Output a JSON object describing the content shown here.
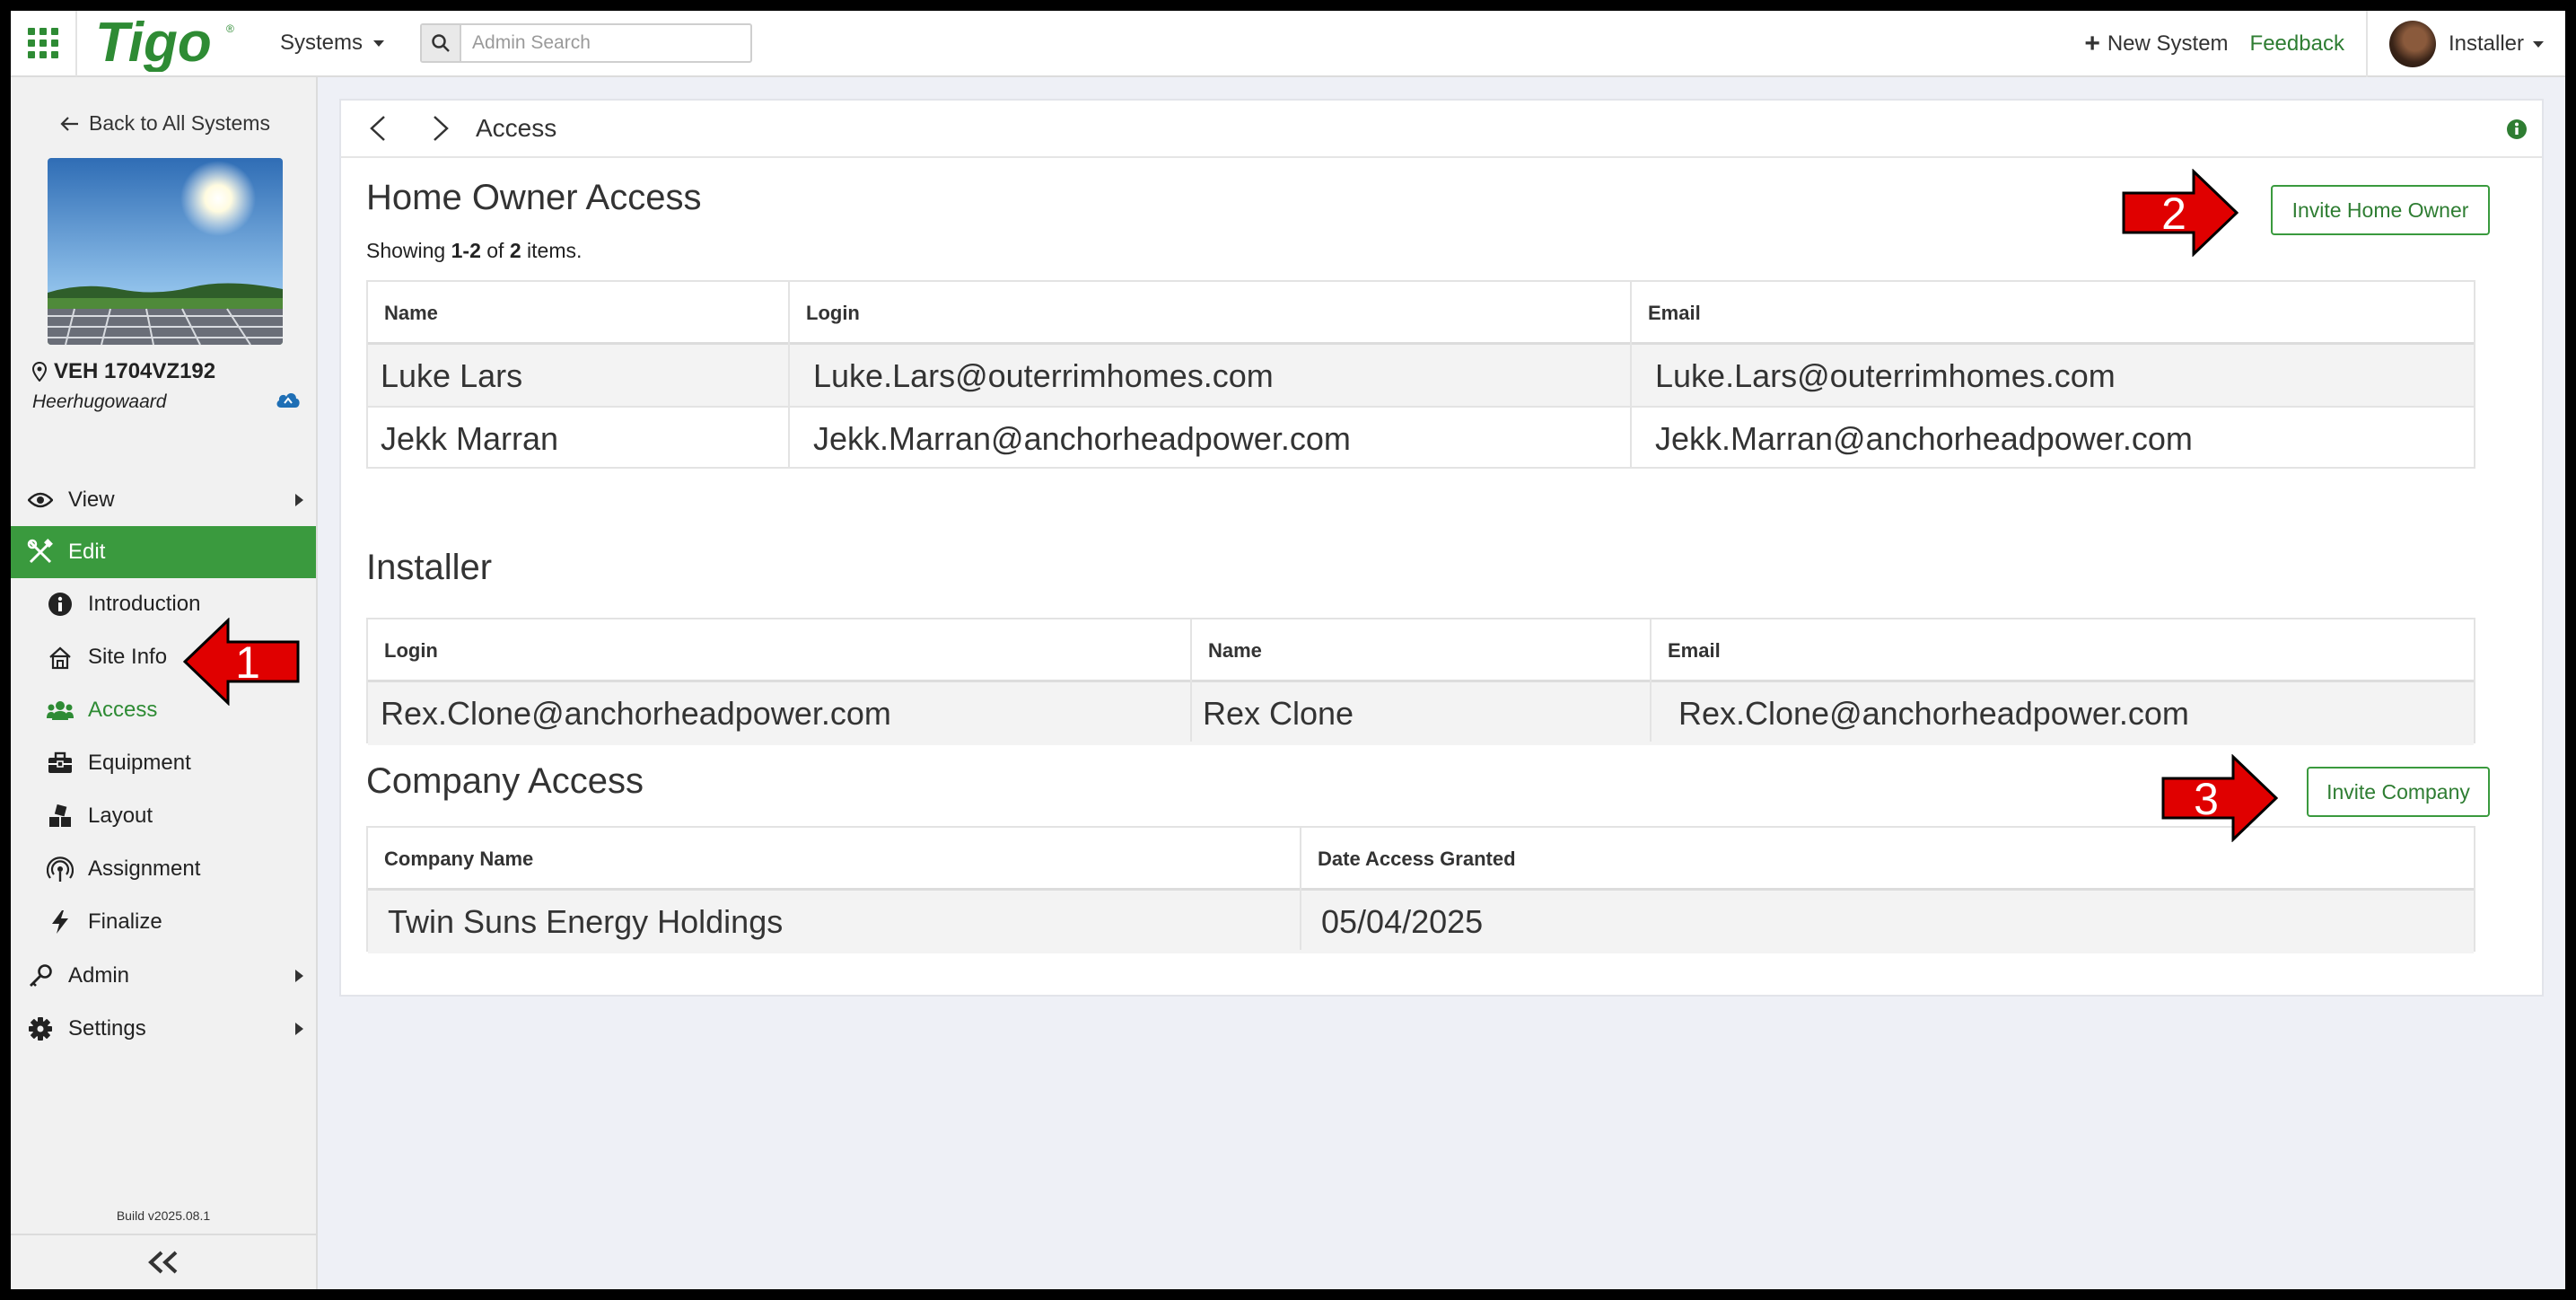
{
  "topbar": {
    "systems_label": "Systems",
    "search_placeholder": "Admin Search",
    "new_system_label": "New System",
    "feedback_label": "Feedback",
    "user_label": "Installer"
  },
  "sidebar": {
    "back_label": "Back to All Systems",
    "site_name": "VEH 1704VZ192",
    "site_city": "Heerhugowaard",
    "menu": {
      "view": "View",
      "edit": "Edit",
      "admin": "Admin",
      "settings": "Settings"
    },
    "edit_items": {
      "introduction": "Introduction",
      "site_info": "Site Info",
      "access": "Access",
      "equipment": "Equipment",
      "layout": "Layout",
      "assignment": "Assignment",
      "finalize": "Finalize"
    },
    "build": "Build v2025.08.1"
  },
  "panel": {
    "title": "Access"
  },
  "home_owner": {
    "title": "Home Owner Access",
    "showing_prefix": "Showing ",
    "showing_range": "1-2",
    "showing_of": " of ",
    "showing_total": "2",
    "showing_suffix": " items.",
    "invite_label": "Invite Home Owner",
    "columns": [
      "Name",
      "Login",
      "Email"
    ],
    "rows": [
      [
        "Luke Lars",
        "Luke.Lars@outerrimhomes.com",
        "Luke.Lars@outerrimhomes.com"
      ],
      [
        "Jekk Marran",
        "Jekk.Marran@anchorheadpower.com",
        "Jekk.Marran@anchorheadpower.com"
      ]
    ]
  },
  "installer": {
    "title": "Installer",
    "columns": [
      "Login",
      "Name",
      "Email"
    ],
    "rows": [
      [
        "Rex.Clone@anchorheadpower.com",
        "Rex Clone",
        "Rex.Clone@anchorheadpower.com"
      ]
    ]
  },
  "company": {
    "title": "Company Access",
    "invite_label": "Invite Company",
    "columns": [
      "Company Name",
      "Date Access Granted"
    ],
    "rows": [
      [
        "Twin Suns Energy Holdings",
        "05/04/2025"
      ]
    ]
  },
  "annotations": {
    "arrow_1": "1",
    "arrow_2": "2",
    "arrow_3": "3",
    "color": "#e00000"
  },
  "colors": {
    "brand_green": "#2e8b34",
    "active_bg": "#3a9a3e"
  }
}
